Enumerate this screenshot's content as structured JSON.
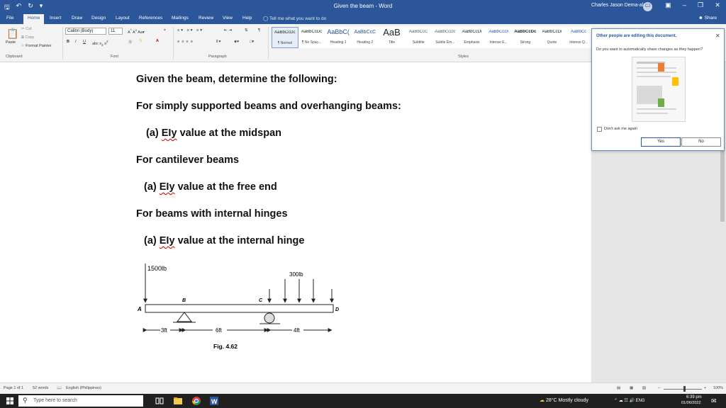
{
  "window": {
    "title": "Given the beam  -  Word",
    "user_name": "Charles Jason Dema-ala",
    "user_initials": "CJ",
    "share_label": "Share",
    "tell_me": "Tell me what you want to do",
    "qat_icons": [
      "save-icon",
      "undo-icon",
      "redo-icon",
      "customize-icon"
    ],
    "accent_color": "#2b579a"
  },
  "tabs": [
    {
      "label": "File",
      "active": false
    },
    {
      "label": "Home",
      "active": true
    },
    {
      "label": "Insert",
      "active": false
    },
    {
      "label": "Draw",
      "active": false
    },
    {
      "label": "Design",
      "active": false
    },
    {
      "label": "Layout",
      "active": false
    },
    {
      "label": "References",
      "active": false
    },
    {
      "label": "Mailings",
      "active": false
    },
    {
      "label": "Review",
      "active": false
    },
    {
      "label": "View",
      "active": false
    },
    {
      "label": "Help",
      "active": false
    }
  ],
  "ribbon": {
    "clipboard": {
      "paste": "Paste",
      "cut": "Cut",
      "copy": "Copy",
      "format_painter": "Format Painter",
      "group_label": "Clipboard"
    },
    "font": {
      "name": "Calibri (Body)",
      "size": "11",
      "group_label": "Font"
    },
    "paragraph": {
      "group_label": "Paragraph"
    },
    "styles": {
      "group_label": "Styles",
      "items": [
        {
          "preview": "AaBbCcDc",
          "name": "¶ Normal",
          "selected": true
        },
        {
          "preview": "AaBbCcDc",
          "name": "¶ No Spac..."
        },
        {
          "preview": "AaBbC(",
          "name": "Heading 1"
        },
        {
          "preview": "AaBbCcC",
          "name": "Heading 2"
        },
        {
          "preview": "AaB",
          "name": "Title"
        },
        {
          "preview": "AaBbCcC",
          "name": "Subtitle"
        },
        {
          "preview": "AaBbCcDc",
          "name": "Subtle Em..."
        },
        {
          "preview": "AaBbCcDi",
          "name": "Emphasis"
        },
        {
          "preview": "AaBbCcDi",
          "name": "Intense E..."
        },
        {
          "preview": "AaBbCcDc",
          "name": "Strong"
        },
        {
          "preview": "AaBbCcDi",
          "name": "Quote"
        },
        {
          "preview": "AaBbCc",
          "name": "Intense Q..."
        }
      ]
    }
  },
  "document": {
    "lines": [
      "Given the beam, determine the following:",
      "For simply supported beams and overhanging beams:",
      "value at the midspan",
      "For cantilever beams",
      "value at the free end",
      "For beams with internal hinges",
      "value at the internal hinge"
    ],
    "prefix": "(a)",
    "ei_term": "EIy",
    "figure": {
      "load_a": "1500lb",
      "load_dist": "300lb",
      "label_a": "A",
      "label_b": "B",
      "label_c": "C",
      "label_d": "D",
      "dim_1": "3ft",
      "dim_2": "6ft",
      "dim_3": "4ft",
      "caption": "Fig. 4.62"
    }
  },
  "popup": {
    "title": "Other people are editing this document.",
    "question": "Do you want to automatically share changes as they happen?",
    "dont_ask": "Don't ask me again",
    "yes": "Yes",
    "no": "No"
  },
  "status": {
    "page": "Page 1 of 1",
    "words": "52 words",
    "language": "English (Philippines)",
    "zoom": "100%",
    "zoom_fraction": 0.55
  },
  "taskbar": {
    "search_placeholder": "Type here to search",
    "weather": "28°C  Mostly cloudy",
    "lang": "ENG",
    "time": "6:39 pm",
    "date": "01/06/2022"
  }
}
